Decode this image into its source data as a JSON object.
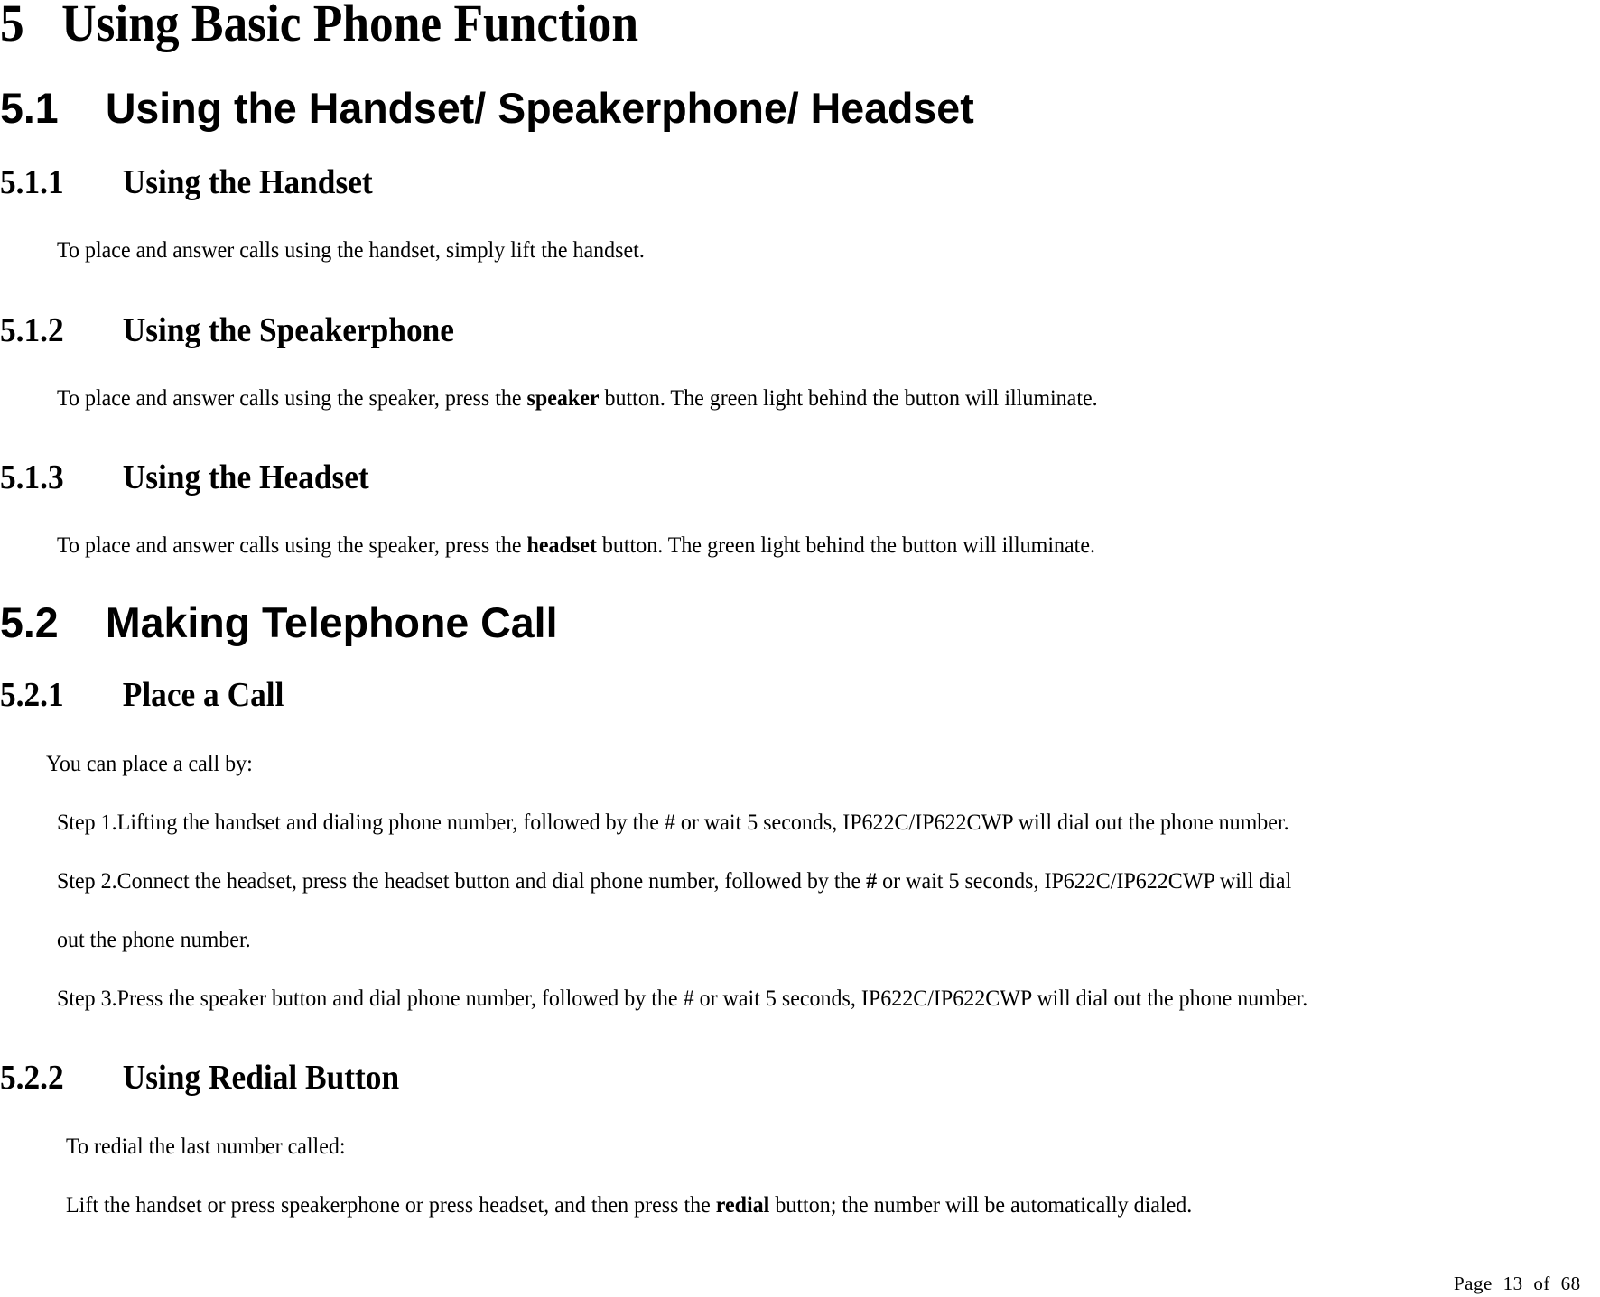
{
  "chapter": {
    "number": "5",
    "title": "Using Basic Phone Function"
  },
  "sections": {
    "s5_1": {
      "number": "5.1",
      "title": "Using the Handset/ Speakerphone/ Headset"
    },
    "s5_1_1": {
      "number": "5.1.1",
      "title": "Using the Handset",
      "body": "To place and answer calls using the handset, simply lift the handset."
    },
    "s5_1_2": {
      "number": "5.1.2",
      "title": "Using the Speakerphone",
      "body_pre": "To place and answer calls using the speaker, press the ",
      "body_bold": "speaker",
      "body_post": " button. The green light behind the button will illuminate."
    },
    "s5_1_3": {
      "number": "5.1.3",
      "title": "Using the Headset",
      "body_pre": "To place and answer calls using the speaker, press the ",
      "body_bold": "headset",
      "body_post": " button. The green light behind the button will illuminate."
    },
    "s5_2": {
      "number": "5.2",
      "title": "Making Telephone Call"
    },
    "s5_2_1": {
      "number": "5.2.1",
      "title": "Place a Call",
      "intro": "You can place a call by:",
      "step1": "Step 1.Lifting the handset and dialing phone number, followed by the # or wait 5 seconds, IP622C/IP622CWP will dial out the phone number.",
      "step2_pre": "Step 2.Connect the headset, press the headset button and dial phone number, followed by the ",
      "step2_bold": "#",
      "step2_post": " or wait 5 seconds, IP622C/IP622CWP will dial",
      "step2_cont": "out the phone number.",
      "step3": "Step 3.Press the speaker button and dial phone number, followed by the # or wait 5 seconds, IP622C/IP622CWP will dial out the phone number."
    },
    "s5_2_2": {
      "number": "5.2.2",
      "title": "Using Redial Button",
      "intro": "To redial the last number called:",
      "body_pre": "Lift the handset or press speakerphone or press headset, and then press the ",
      "body_bold": "redial",
      "body_post": " button; the number will be automatically dialed."
    }
  },
  "footer": {
    "page_label": "Page",
    "page_number": "13",
    "of_label": "of",
    "total_pages": "68"
  }
}
